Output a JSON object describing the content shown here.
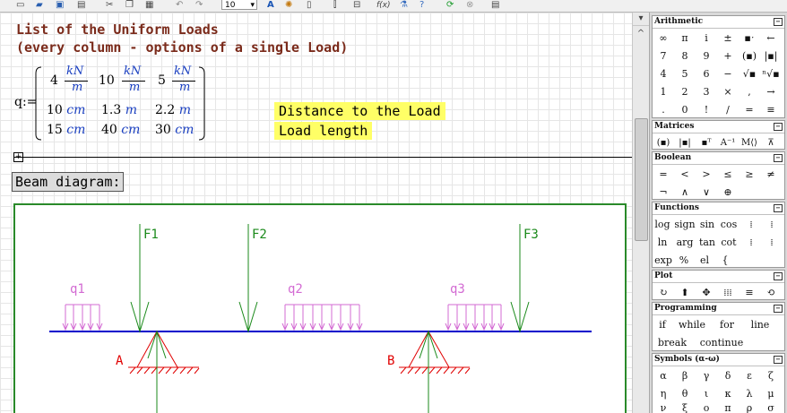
{
  "toolbar": {
    "font_size": "10",
    "items": [
      "new-icon",
      "open-icon",
      "save-icon",
      "print-icon",
      "cut-icon",
      "copy-icon",
      "paste-icon",
      "undo-icon",
      "redo-icon",
      "font-size-dropdown",
      "text-icon",
      "color-palette-icon",
      "resource-icon",
      "align-vertical-icon",
      "align-horizontal-icon",
      "insert-function-icon",
      "insert-unit-icon",
      "help-icon",
      "recalculate-icon",
      "stop-icon",
      "palettes-icon"
    ]
  },
  "worksheet": {
    "title_line1": "List of the Uniform Loads",
    "title_line2": "(every column - options of a single Load)",
    "matrix_var": "q:=",
    "row1": [
      {
        "num": "4",
        "unit_top": "kN",
        "unit_bottom": "m"
      },
      {
        "num": "10",
        "unit_top": "kN",
        "unit_bottom": "m"
      },
      {
        "num": "5",
        "unit_top": "kN",
        "unit_bottom": "m"
      }
    ],
    "row2": [
      {
        "num": "10",
        "unit": "cm"
      },
      {
        "num": "1.3",
        "unit": "m"
      },
      {
        "num": "2.2",
        "unit": "m"
      }
    ],
    "row3": [
      {
        "num": "15",
        "unit": "cm"
      },
      {
        "num": "40",
        "unit": "cm"
      },
      {
        "num": "30",
        "unit": "cm"
      }
    ],
    "hint_distance": "Distance to the Load",
    "hint_length": "Load length",
    "region_toggle": "+",
    "beam_label": "Beam diagram:"
  },
  "diagram": {
    "forces": [
      "F1",
      "F2",
      "F3"
    ],
    "loads": [
      "q1",
      "q2",
      "q3"
    ],
    "supports": [
      "A",
      "B"
    ],
    "colors": {
      "force": "#1b8a1b",
      "load": "#d36bd3",
      "beam": "#0000cc",
      "support": "#e00000",
      "frame": "#2a8a2a"
    }
  },
  "palettes": {
    "arithmetic": {
      "title": "Arithmetic",
      "rows": [
        [
          "∞",
          "π",
          "i",
          "±",
          "▪ˑ",
          "←"
        ],
        [
          "7",
          "8",
          "9",
          "+",
          "(▪)",
          "|▪|"
        ],
        [
          "4",
          "5",
          "6",
          "−",
          "√▪",
          "ⁿ√▪"
        ],
        [
          "1",
          "2",
          "3",
          "×",
          ",",
          "→"
        ],
        [
          ".",
          "0",
          "!",
          "/",
          "=",
          "≡"
        ]
      ]
    },
    "matrices": {
      "title": "Matrices",
      "rows": [
        [
          "(▪)",
          "|▪|",
          "▪ᵀ",
          "A⁻¹",
          "M⟨⟩",
          "⊼"
        ]
      ]
    },
    "boolean": {
      "title": "Boolean",
      "rows": [
        [
          "=",
          "<",
          ">",
          "≤",
          "≥",
          "≠"
        ],
        [
          "¬",
          "∧",
          "∨",
          "⊕"
        ]
      ]
    },
    "functions": {
      "title": "Functions",
      "rows": [
        [
          "log",
          "sign",
          "sin",
          "cos",
          "⁞",
          "⁞"
        ],
        [
          "ln",
          "arg",
          "tan",
          "cot",
          "⁞",
          "⁞"
        ],
        [
          "exp",
          "%",
          "el",
          "{"
        ]
      ]
    },
    "plot": {
      "title": "Plot",
      "rows": [
        [
          "↻",
          "⬆",
          "✥",
          "⁞⁞⁞",
          "≡",
          "⟲"
        ]
      ]
    },
    "programming": {
      "title": "Programming",
      "rows": [
        [
          "if",
          "while",
          "for",
          "line"
        ],
        [
          "break",
          "continue"
        ]
      ]
    },
    "symbols": {
      "title": "Symbols (α-ω)",
      "rows": [
        [
          "α",
          "β",
          "γ",
          "δ",
          "ε",
          "ζ"
        ],
        [
          "η",
          "θ",
          "ι",
          "κ",
          "λ",
          "μ"
        ],
        [
          "ν",
          "ξ",
          "ο",
          "π",
          "ρ",
          "σ"
        ]
      ]
    },
    "collapse_glyph": "−"
  }
}
